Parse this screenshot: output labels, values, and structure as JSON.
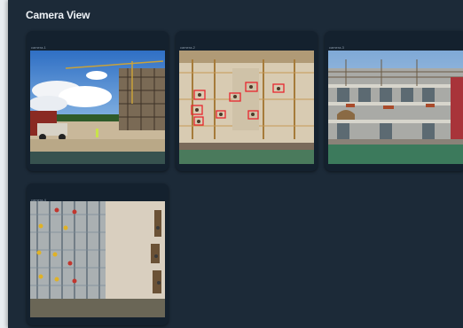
{
  "panel": {
    "title": "Camera View"
  },
  "cameras": [
    {
      "label": "camera-1",
      "scene": "crane-yard"
    },
    {
      "label": "camera-2",
      "scene": "aerial-site-detections"
    },
    {
      "label": "camera-3",
      "scene": "building-scaffold"
    },
    {
      "label": "camera-4",
      "scene": "aerial-scaffold-workers"
    }
  ],
  "colors": {
    "panel_bg": "#1c2a38",
    "card_bg": "#14212e",
    "detection_box": "#e8262e"
  }
}
